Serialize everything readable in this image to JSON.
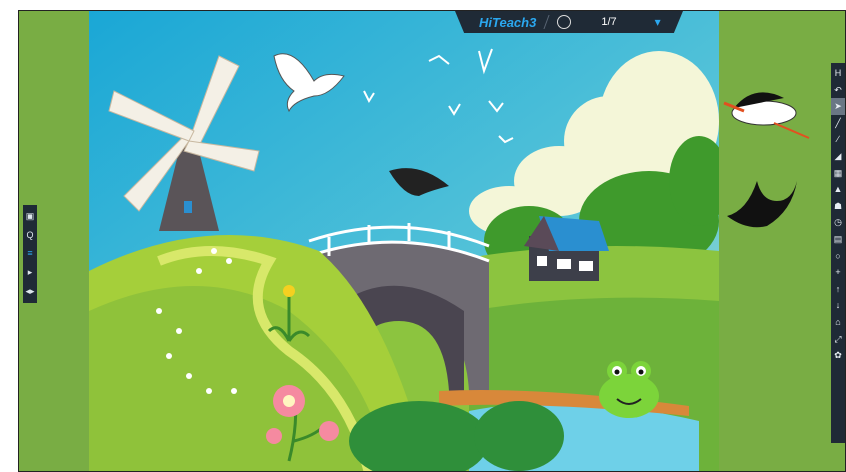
{
  "app": {
    "brand_name": "HiTeach",
    "brand_version": "3",
    "page_indicator": "1/7"
  },
  "left_toolbar": {
    "items": [
      {
        "name": "screen-icon",
        "glyph": "▣"
      },
      {
        "name": "search-icon",
        "glyph": "Q"
      },
      {
        "name": "menu-icon",
        "glyph": "≡",
        "active": true
      },
      {
        "name": "play-icon",
        "glyph": "▸"
      },
      {
        "name": "audio-icon",
        "glyph": "◂▸"
      }
    ]
  },
  "right_toolbar": {
    "header": "H",
    "items": [
      {
        "name": "undo-icon",
        "glyph": "↶"
      },
      {
        "name": "select-icon",
        "glyph": "➤",
        "selected": true
      },
      {
        "name": "pen-icon",
        "glyph": "╱"
      },
      {
        "name": "line-icon",
        "glyph": "∕"
      },
      {
        "name": "eraser-icon",
        "glyph": "◢"
      },
      {
        "name": "grid-icon",
        "glyph": "▦"
      },
      {
        "name": "stamp-icon",
        "glyph": "▲"
      },
      {
        "name": "group-icon",
        "glyph": "☗"
      },
      {
        "name": "timer-icon",
        "glyph": "◷"
      },
      {
        "name": "calendar-icon",
        "glyph": "▤"
      },
      {
        "name": "zoom-icon",
        "glyph": "○"
      },
      {
        "name": "add-icon",
        "glyph": "+"
      },
      {
        "name": "up-icon",
        "glyph": "↑"
      },
      {
        "name": "down-icon",
        "glyph": "↓"
      },
      {
        "name": "museum-icon",
        "glyph": "⌂"
      },
      {
        "name": "expand-icon",
        "glyph": "⤢"
      },
      {
        "name": "settings-icon",
        "glyph": "✿"
      }
    ]
  },
  "colors": {
    "background_green": "#79ad44",
    "toolbar": "#1f2a36",
    "accent": "#2ba8f0",
    "sky": "#3fb6d8"
  }
}
